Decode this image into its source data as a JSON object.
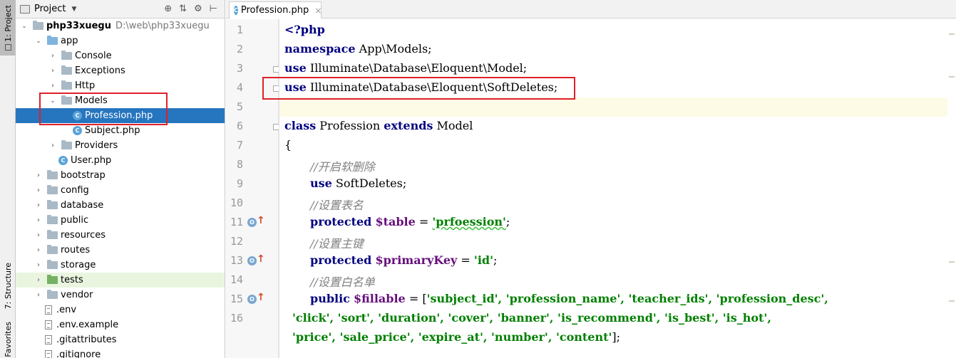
{
  "toolwindows": {
    "project": "1: Project",
    "structure": "7: Structure",
    "favorites": "Favorites"
  },
  "project_panel": {
    "title": "Project",
    "tree": [
      {
        "label": "php33xuegu",
        "detail": "D:\\web\\php33xuegu",
        "kind": "root-folder",
        "expanded": true,
        "depth": 0
      },
      {
        "label": "app",
        "kind": "source-folder",
        "expanded": true,
        "depth": 1
      },
      {
        "label": "Console",
        "kind": "folder",
        "expanded": false,
        "depth": 2
      },
      {
        "label": "Exceptions",
        "kind": "folder",
        "expanded": false,
        "depth": 2
      },
      {
        "label": "Http",
        "kind": "folder",
        "expanded": false,
        "depth": 2
      },
      {
        "label": "Models",
        "kind": "folder",
        "expanded": true,
        "depth": 2
      },
      {
        "label": "Profession.php",
        "kind": "php-class",
        "selected": true,
        "depth": 3
      },
      {
        "label": "Subject.php",
        "kind": "php-class",
        "depth": 3
      },
      {
        "label": "Providers",
        "kind": "folder",
        "expanded": false,
        "depth": 2
      },
      {
        "label": "User.php",
        "kind": "php-class",
        "depth": 2
      },
      {
        "label": "bootstrap",
        "kind": "folder",
        "expanded": false,
        "depth": 1
      },
      {
        "label": "config",
        "kind": "folder",
        "expanded": false,
        "depth": 1
      },
      {
        "label": "database",
        "kind": "folder",
        "expanded": false,
        "depth": 1
      },
      {
        "label": "public",
        "kind": "folder",
        "expanded": false,
        "depth": 1
      },
      {
        "label": "resources",
        "kind": "folder",
        "expanded": false,
        "depth": 1
      },
      {
        "label": "routes",
        "kind": "folder",
        "expanded": false,
        "depth": 1
      },
      {
        "label": "storage",
        "kind": "folder",
        "expanded": false,
        "depth": 1
      },
      {
        "label": "tests",
        "kind": "test-folder",
        "expanded": false,
        "depth": 1
      },
      {
        "label": "vendor",
        "kind": "folder",
        "expanded": false,
        "depth": 1
      },
      {
        "label": ".env",
        "kind": "file",
        "depth": 1
      },
      {
        "label": ".env.example",
        "kind": "file",
        "depth": 1
      },
      {
        "label": ".gitattributes",
        "kind": "file",
        "depth": 1
      },
      {
        "label": ".gitignore",
        "kind": "file",
        "depth": 1
      }
    ]
  },
  "editor": {
    "tab_label": "Profession.php",
    "line_numbers": [
      "1",
      "2",
      "3",
      "4",
      "5",
      "6",
      "7",
      "8",
      "9",
      "10",
      "11",
      "12",
      "13",
      "14",
      "15",
      "16"
    ],
    "code": {
      "l1_open": "<?php",
      "l2_kw": "namespace",
      "l2_rest": " App\\Models;",
      "l3_kw": "use",
      "l3_rest": " Illuminate\\Database\\Eloquent\\Model;",
      "l4_kw": "use",
      "l4_rest": " Illuminate\\Database\\Eloquent\\SoftDeletes;",
      "l6_kw1": "class",
      "l6_mid": " Profession ",
      "l6_kw2": "extends",
      "l6_end": " Model",
      "l7": "{",
      "l8_comment": "//开启软删除",
      "l9_kw": "use",
      "l9_rest": " SoftDeletes;",
      "l10_comment": "//设置表名",
      "l11_kw": "protected",
      "l11_var": "$table",
      "l11_eq": " = ",
      "l11_str": "'prfoession'",
      "l11_end": ";",
      "l12_comment": "//设置主键",
      "l13_kw": "protected",
      "l13_var": "$primaryKey",
      "l13_eq": " = ",
      "l13_str": "'id'",
      "l13_end": ";",
      "l14_comment": "//设置白名单",
      "l15_kw": "public",
      "l15_var": "$fillable",
      "l15_eq": " = [",
      "l15_items": "'subject_id', 'profession_name', 'teacher_ids', 'profession_desc',",
      "l15b_items": "'click', 'sort', 'duration', 'cover', 'banner', 'is_recommend', 'is_best', 'is_hot',",
      "l15c_items": "'price', 'sale_price', 'expire_at', 'number', 'content'",
      "l15c_end": "];"
    },
    "gutter_marker": "O"
  },
  "colors": {
    "selection": "#2675bf",
    "annotation_box": "#e0202a",
    "keyword": "#000080",
    "string": "#008000",
    "variable": "#660e7a",
    "comment": "#808080"
  }
}
